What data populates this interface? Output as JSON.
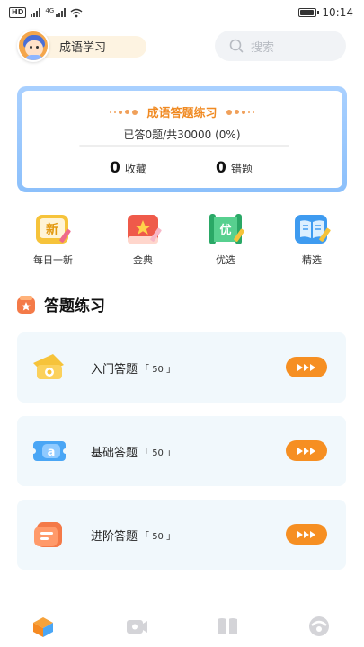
{
  "status_bar": {
    "hd_badge": "HD",
    "network": "4G",
    "time": "10:14",
    "battery_level": 0.9,
    "icons": [
      "hd-icon",
      "signal-icon",
      "wifi-icon",
      "battery-icon"
    ]
  },
  "header": {
    "user_name": "成语学习",
    "search_placeholder": "搜索"
  },
  "progress_card": {
    "title": "成语答题练习",
    "progress_text": "已答0题/共30000  (0%)",
    "progress_fraction": 0,
    "favorites_count": "0",
    "favorites_label": "收藏",
    "mistakes_count": "0",
    "mistakes_label": "错题"
  },
  "shortcuts": [
    {
      "label": "每日一新",
      "glyph": "新",
      "icon": "daily-new-icon",
      "color": "#f6c33a"
    },
    {
      "label": "金典",
      "icon": "classic-book-icon",
      "color": "#ef5a4a"
    },
    {
      "label": "优选",
      "glyph": "优",
      "icon": "scroll-icon",
      "color": "#3fc27e"
    },
    {
      "label": "精选",
      "icon": "open-book-icon",
      "color": "#3e9bf0"
    }
  ],
  "section": {
    "title": "答题练习"
  },
  "levels": [
    {
      "label": "入门答题",
      "count": "「 50 」",
      "icon": "bag-icon",
      "color": "#f6c33a"
    },
    {
      "label": "基础答题",
      "count": "「 50 」",
      "icon": "ticket-a-icon",
      "color": "#4aa6f5"
    },
    {
      "label": "进阶答题",
      "count": "「 50 」",
      "icon": "card-icon",
      "color": "#f47a48"
    }
  ],
  "bottom_nav": [
    {
      "name": "home",
      "icon": "home-box-icon",
      "active": true
    },
    {
      "name": "video",
      "icon": "video-icon",
      "active": false
    },
    {
      "name": "book",
      "icon": "book-icon",
      "active": false
    },
    {
      "name": "profile",
      "icon": "profile-icon",
      "active": false
    }
  ],
  "colors": {
    "accent": "#f68f22",
    "card_border": "#9cc8fd",
    "level_bg": "#f1f8fc",
    "inactive_nav": "#d4d4d8"
  }
}
